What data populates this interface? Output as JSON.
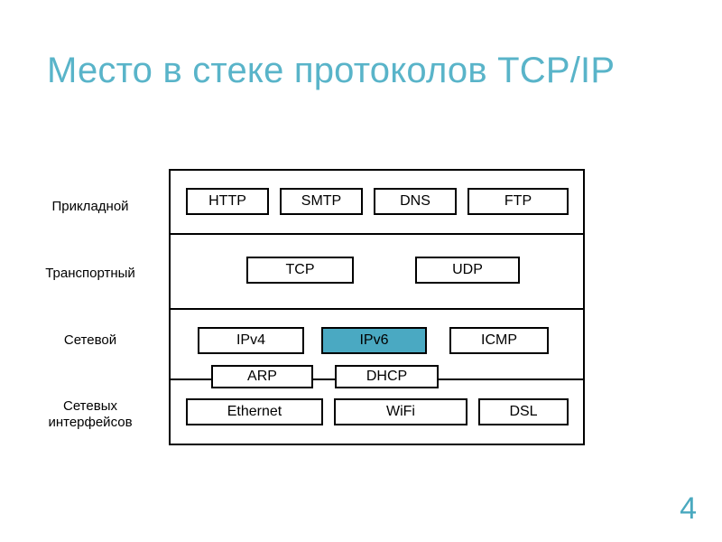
{
  "slide": {
    "title": "Место в стеке протоколов TCP/IP",
    "number": "4",
    "accent_color": "#59b4c9",
    "highlight_color": "#4aa9c2"
  },
  "diagram": {
    "type": "protocol-stack",
    "layers": [
      {
        "label": "Прикладной",
        "boxes": [
          {
            "name": "HTTP",
            "highlighted": false
          },
          {
            "name": "SMTP",
            "highlighted": false
          },
          {
            "name": "DNS",
            "highlighted": false
          },
          {
            "name": "FTP",
            "highlighted": false
          }
        ]
      },
      {
        "label": "Транспортный",
        "boxes": [
          {
            "name": "TCP",
            "highlighted": false
          },
          {
            "name": "UDP",
            "highlighted": false
          }
        ]
      },
      {
        "label": "Сетевой",
        "boxes": [
          {
            "name": "IPv4",
            "highlighted": false
          },
          {
            "name": "IPv6",
            "highlighted": true
          },
          {
            "name": "ICMP",
            "highlighted": false
          }
        ]
      },
      {
        "label": "Сетевых\nинтерфейсов",
        "boxes": [
          {
            "name": "Ethernet",
            "highlighted": false
          },
          {
            "name": "WiFi",
            "highlighted": false
          },
          {
            "name": "DSL",
            "highlighted": false
          }
        ]
      }
    ],
    "straddling_boxes": [
      {
        "name": "ARP",
        "highlighted": false
      },
      {
        "name": "DHCP",
        "highlighted": false
      }
    ]
  }
}
